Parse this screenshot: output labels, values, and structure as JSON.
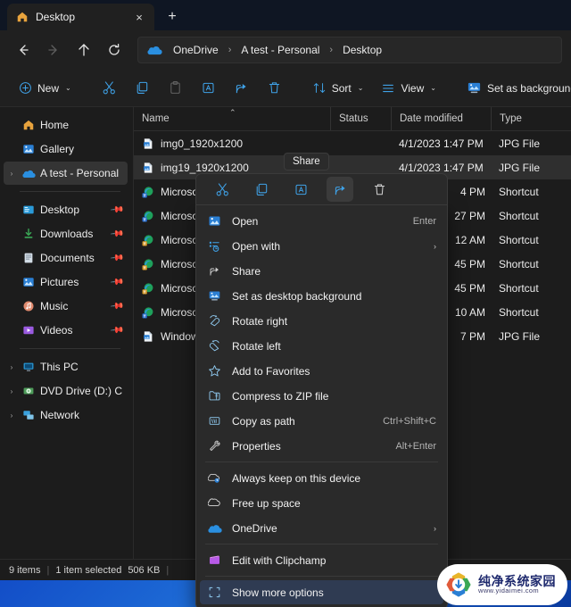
{
  "window": {
    "tab": {
      "title": "Desktop",
      "icon": "home-icon",
      "close_label": "×"
    },
    "new_tab_label": "+"
  },
  "nav": {
    "back": "←",
    "forward": "→",
    "up": "↑",
    "refresh": "⟳",
    "breadcrumb": [
      "OneDrive",
      "A test - Personal",
      "Desktop"
    ],
    "separator": "›"
  },
  "toolbar": {
    "new_label": "New",
    "sort_label": "Sort",
    "view_label": "View",
    "set_background_label": "Set as background",
    "chevron": "⌄",
    "items": [
      {
        "name": "cut",
        "label": "Cut"
      },
      {
        "name": "copy",
        "label": "Copy"
      },
      {
        "name": "paste",
        "label": "Paste"
      },
      {
        "name": "rename",
        "label": "Rename"
      },
      {
        "name": "share",
        "label": "Share"
      },
      {
        "name": "delete",
        "label": "Delete"
      }
    ]
  },
  "sidebar": {
    "items": [
      {
        "label": "Home",
        "icon": "home-icon",
        "expandable": false,
        "pinned": false,
        "selected": false
      },
      {
        "label": "Gallery",
        "icon": "gallery-icon",
        "expandable": false,
        "pinned": false,
        "selected": false
      },
      {
        "label": "A test - Personal",
        "icon": "onedrive-icon",
        "expandable": true,
        "pinned": false,
        "selected": true
      }
    ],
    "pinned": [
      {
        "label": "Desktop",
        "icon": "desktop-icon",
        "pinned": true
      },
      {
        "label": "Downloads",
        "icon": "downloads-icon",
        "pinned": true
      },
      {
        "label": "Documents",
        "icon": "documents-icon",
        "pinned": true
      },
      {
        "label": "Pictures",
        "icon": "pictures-icon",
        "pinned": true
      },
      {
        "label": "Music",
        "icon": "music-icon",
        "pinned": true
      },
      {
        "label": "Videos",
        "icon": "videos-icon",
        "pinned": true
      }
    ],
    "devices": [
      {
        "label": "This PC",
        "icon": "pc-icon",
        "expandable": true
      },
      {
        "label": "DVD Drive (D:) CCC",
        "icon": "dvd-icon",
        "expandable": true
      },
      {
        "label": "Network",
        "icon": "network-icon",
        "expandable": true
      }
    ],
    "expand_glyph": "›",
    "pin_glyph": "📌"
  },
  "filelist": {
    "columns": [
      "Name",
      "Status",
      "Date modified",
      "Type"
    ],
    "sort_indicator": "⌃",
    "rows": [
      {
        "name": "img0_1920x1200",
        "status": "",
        "date": "4/1/2023 1:47 PM",
        "type": "JPG File",
        "icon": "jpg-icon",
        "selected": false
      },
      {
        "name": "img19_1920x1200",
        "status": "",
        "date": "4/1/2023 1:47 PM",
        "type": "JPG File",
        "icon": "jpg-icon",
        "selected": true
      },
      {
        "name": "Microsoft E",
        "status": "",
        "date": "4 PM",
        "type": "Shortcut",
        "icon": "edge-icon",
        "selected": false
      },
      {
        "name": "Microsoft E",
        "status": "",
        "date": "27 PM",
        "type": "Shortcut",
        "icon": "edge-icon",
        "selected": false
      },
      {
        "name": "Microsoft E",
        "status": "",
        "date": "12 AM",
        "type": "Shortcut",
        "icon": "edge-icon",
        "selected": false
      },
      {
        "name": "Microsoft E",
        "status": "",
        "date": "45 PM",
        "type": "Shortcut",
        "icon": "edge-icon",
        "selected": false
      },
      {
        "name": "Microsoft E",
        "status": "",
        "date": "45 PM",
        "type": "Shortcut",
        "icon": "edge-icon",
        "selected": false
      },
      {
        "name": "Microsoft E",
        "status": "",
        "date": "10 AM",
        "type": "Shortcut",
        "icon": "edge-icon",
        "selected": false
      },
      {
        "name": "WindowsLi",
        "status": "",
        "date": "7 PM",
        "type": "JPG File",
        "icon": "jpg-icon",
        "selected": false
      }
    ]
  },
  "tooltip": {
    "text": "Share"
  },
  "context_menu": {
    "groups": [
      {
        "items": [
          {
            "label": "Open",
            "icon": "open-image-icon",
            "accel": "Enter",
            "submenu": false,
            "highlight": false
          },
          {
            "label": "Open with",
            "icon": "open-with-icon",
            "accel": "",
            "submenu": true,
            "highlight": false
          },
          {
            "label": "Share",
            "icon": "share-icon",
            "accel": "",
            "submenu": false,
            "highlight": false
          },
          {
            "label": "Set as desktop background",
            "icon": "set-background-icon",
            "accel": "",
            "submenu": false,
            "highlight": false
          },
          {
            "label": "Rotate right",
            "icon": "rotate-right-icon",
            "accel": "",
            "submenu": false,
            "highlight": false
          },
          {
            "label": "Rotate left",
            "icon": "rotate-left-icon",
            "accel": "",
            "submenu": false,
            "highlight": false
          },
          {
            "label": "Add to Favorites",
            "icon": "star-icon",
            "accel": "",
            "submenu": false,
            "highlight": false
          },
          {
            "label": "Compress to ZIP file",
            "icon": "zip-icon",
            "accel": "",
            "submenu": false,
            "highlight": false
          },
          {
            "label": "Copy as path",
            "icon": "copy-path-icon",
            "accel": "Ctrl+Shift+C",
            "submenu": false,
            "highlight": false
          },
          {
            "label": "Properties",
            "icon": "properties-icon",
            "accel": "Alt+Enter",
            "submenu": false,
            "highlight": false
          }
        ]
      },
      {
        "items": [
          {
            "label": "Always keep on this device",
            "icon": "cloud-keep-icon",
            "accel": "",
            "submenu": false,
            "highlight": false
          },
          {
            "label": "Free up space",
            "icon": "cloud-free-icon",
            "accel": "",
            "submenu": false,
            "highlight": false
          },
          {
            "label": "OneDrive",
            "icon": "onedrive-icon",
            "accel": "",
            "submenu": true,
            "highlight": false
          }
        ]
      },
      {
        "items": [
          {
            "label": "Edit with Clipchamp",
            "icon": "clipchamp-icon",
            "accel": "",
            "submenu": false,
            "highlight": false
          }
        ]
      },
      {
        "items": [
          {
            "label": "Show more options",
            "icon": "more-options-icon",
            "accel": "",
            "submenu": false,
            "highlight": true
          }
        ]
      }
    ],
    "submenu_glyph": "›"
  },
  "statusbar": {
    "item_count": "9 items",
    "selection": "1 item selected",
    "size": "506 KB",
    "separator": "|"
  },
  "watermark": {
    "main": "纯净系统家园",
    "sub": "www.yidaimei.com"
  },
  "colors": {
    "accent": "#3fa2e8",
    "window_bg": "#1c1c1c",
    "chrome_bg": "#202020",
    "menu_bg": "#2a2a2a",
    "highlight": "#2f3b52",
    "selection": "#2f2f2f",
    "desktop": "#0d3fc0"
  }
}
